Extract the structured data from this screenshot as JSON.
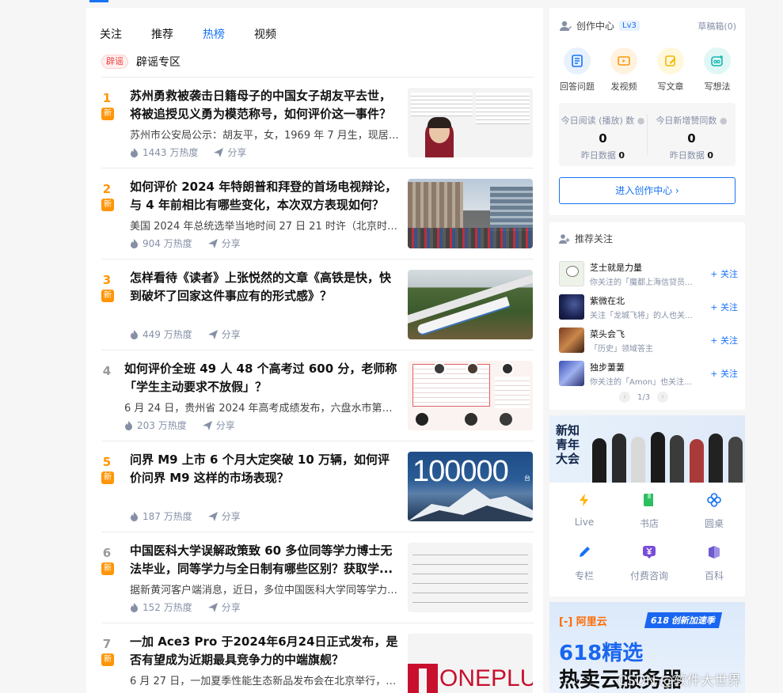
{
  "tabs": [
    {
      "label": "关注"
    },
    {
      "label": "推荐"
    },
    {
      "label": "热榜"
    },
    {
      "label": "视频"
    }
  ],
  "rumor": {
    "badge": "辟谣",
    "label": "辟谣专区"
  },
  "hot_items": [
    {
      "rank": "1",
      "badge": "新",
      "title": "苏州勇救被袭击日籍母子的中国女子胡友平去世，将被追授见义勇为模范称号，如何评价这一事件？",
      "excerpt": "苏州市公安局公示：胡友平，女，1969 年 7 月生，现居苏...",
      "heat": "1443 万热度",
      "share": "分享"
    },
    {
      "rank": "2",
      "badge": "新",
      "title": "如何评价 2024 年特朗普和拜登的首场电视辩论，与 4 年前相比有哪些变化，本次双方表现如何？",
      "excerpt": "美国 2024 年总统选举当地时间 27 日 21 时许（北京时间 ...",
      "heat": "904 万热度",
      "share": "分享"
    },
    {
      "rank": "3",
      "badge": "新",
      "title": "怎样看待《读者》上张悦然的文章《高铁是快，快到破坏了回家这件事应有的形式感》？",
      "excerpt": "",
      "heat": "449 万热度",
      "share": "分享"
    },
    {
      "rank": "4",
      "badge": "",
      "title": "如何评价全班 49 人 48 个高考过 600 分，老师称「学生主动要求不放假」？",
      "excerpt": "6 月 24 日，贵州省 2024 年高考成绩发布，六盘水市第二中...",
      "heat": "203 万热度",
      "share": "分享"
    },
    {
      "rank": "5",
      "badge": "新",
      "title": "问界 M9 上市 6 个月大定突破 10 万辆，如何评价问界 M9 这样的市场表现？",
      "excerpt": "",
      "heat": "187 万热度",
      "share": "分享"
    },
    {
      "rank": "6",
      "badge": "新",
      "title": "中国医科大学误解政策致 60 多位同等学力博士无法毕业，同等学力与全日制有哪些区别？获取学...",
      "excerpt": "据新黄河客户端消息，近日，多位中国医科大学同等学力博...",
      "heat": "152 万热度",
      "share": "分享"
    },
    {
      "rank": "7",
      "badge": "新",
      "title": "一加 Ace3 Pro 于2024年6月24日正式发布，是否有望成为近期最具竞争力的中端旗舰？",
      "excerpt": "6 月 27 日，一加夏季性能生态新品发布会在北京举行，发...",
      "heat": "",
      "share": ""
    }
  ],
  "thumb_text": {
    "item5": "100000",
    "item5_unit": "台",
    "item7": "ONEPLU"
  },
  "creator": {
    "title": "创作中心",
    "level": "Lv3",
    "drafts": "草稿箱(0)",
    "tools": [
      {
        "label": "回答问题",
        "icon": "answer-icon",
        "color": "#1772f6",
        "bg": "#e8f1fe"
      },
      {
        "label": "发视频",
        "icon": "video-icon",
        "color": "#ff9607",
        "bg": "#fff3e0"
      },
      {
        "label": "写文章",
        "icon": "write-icon",
        "color": "#f5b800",
        "bg": "#fff8dc"
      },
      {
        "label": "写想法",
        "icon": "idea-icon",
        "color": "#12b7b0",
        "bg": "#e0f7f6"
      }
    ],
    "stats": [
      {
        "label": "今日阅读 (播放) 数",
        "value": "0",
        "yday_label": "昨日数据",
        "yday_value": "0"
      },
      {
        "label": "今日新增赞同数",
        "value": "0",
        "yday_label": "昨日数据",
        "yday_value": "0"
      }
    ],
    "enter_button": "进入创作中心 ›"
  },
  "recommend": {
    "title": "推荐关注",
    "follow_label": "+ 关注",
    "users": [
      {
        "name": "芝士就是力量",
        "desc": "你关注的「魔都上海信贷员..."
      },
      {
        "name": "紫微在北",
        "desc": "关注「龙城飞将」的人也关..."
      },
      {
        "name": "菜头会飞",
        "desc": "「历史」领域答主"
      },
      {
        "name": "独步萋萋",
        "desc": "你关注的「Amon」也关注..."
      }
    ],
    "pager": "1/3"
  },
  "quick_links": [
    {
      "label": "Live",
      "icon": "lightning-icon",
      "color": "#ffb300"
    },
    {
      "label": "书店",
      "icon": "book-icon",
      "color": "#2bbf5f"
    },
    {
      "label": "圆桌",
      "icon": "flower-icon",
      "color": "#1772f6"
    },
    {
      "label": "专栏",
      "icon": "pen-icon",
      "color": "#1772f6"
    },
    {
      "label": "付费咨询",
      "icon": "yen-icon",
      "color": "#7a4dd8"
    },
    {
      "label": "百科",
      "icon": "encyclopedia-icon",
      "color": "#6d5bd0"
    }
  ],
  "banner": {
    "text": "新知青年大会"
  },
  "ad": {
    "logo": "[-] 阿里云",
    "tag": "618 创新加速季",
    "line1": "618精选",
    "line2": "热卖云服务器"
  },
  "watermark": "CSDN @软件大世界"
}
